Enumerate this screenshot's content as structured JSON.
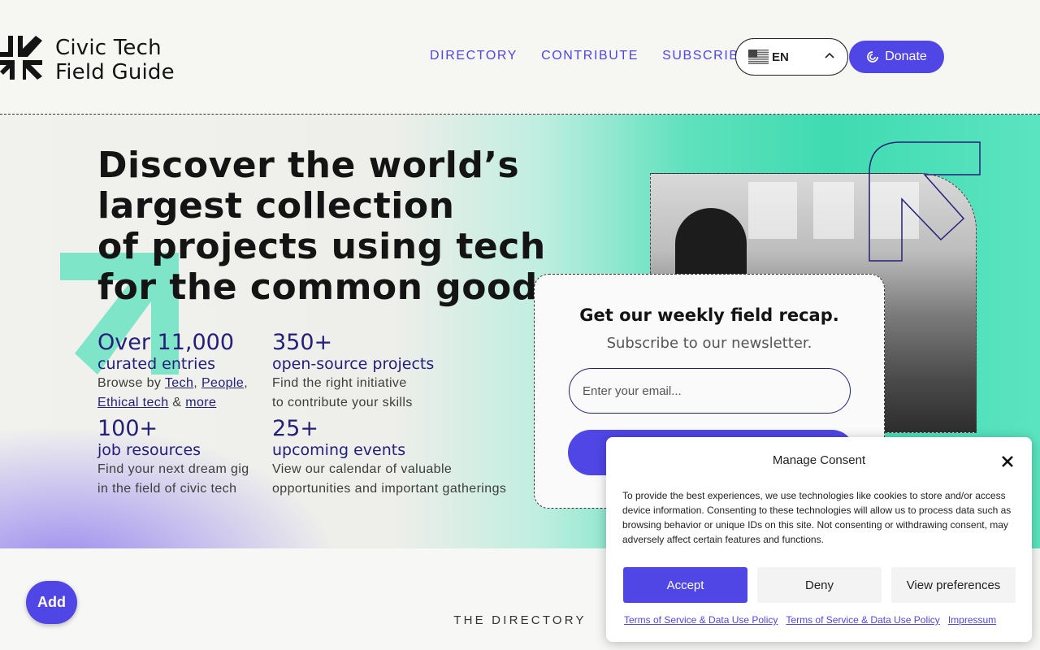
{
  "header": {
    "logo_line1": "Civic Tech",
    "logo_line2": "Field Guide",
    "nav": [
      "DIRECTORY",
      "CONTRIBUTE",
      "SUBSCRIBE"
    ],
    "language": "EN",
    "donate_label": "Donate"
  },
  "hero": {
    "heading_lines": [
      "Discover the world’s",
      "largest collection",
      "of projects using tech",
      "for the common good."
    ],
    "stats": [
      {
        "num": "Over 11,000",
        "sub": "curated entries",
        "desc_prefix": "Browse by ",
        "links": [
          "Tech",
          "People",
          "Ethical tech",
          "more"
        ]
      },
      {
        "num": "350+",
        "sub": "open-source projects",
        "desc_line1": "Find the right initiative",
        "desc_line2": "to contribute your skills"
      },
      {
        "num": "100+",
        "sub": "job resources",
        "desc_line1": "Find your next dream gig",
        "desc_line2": "in the field of civic tech"
      },
      {
        "num": "25+",
        "sub": "upcoming events",
        "desc_line1": "View our calendar of valuable",
        "desc_line2": "opportunities and important gatherings"
      }
    ]
  },
  "newsletter": {
    "title": "Get our weekly field recap.",
    "subtitle": "Subscribe to our newsletter.",
    "email_placeholder": "Enter your email..."
  },
  "add_label": "Add",
  "directory": {
    "eyebrow": "THE DIRECTORY"
  },
  "consent": {
    "title": "Manage Consent",
    "text": "To provide the best experiences, we use technologies like cookies to store and/or access device information. Consenting to these technologies will allow us to process data such as browsing behavior or unique IDs on this site. Not consenting or withdrawing consent, may adversely affect certain features and functions.",
    "accept": "Accept",
    "deny": "Deny",
    "preferences": "View preferences",
    "links": [
      "Terms of Service & Data Use Policy",
      "Terms of Service & Data Use Policy",
      "Impressum"
    ]
  },
  "colors": {
    "accent": "#4f46e5",
    "navy": "#24207a",
    "mint": "#3fdbb1",
    "lavender": "#8b78f0"
  },
  "icons": {
    "logo": "logo-arrows-icon",
    "flag": "us-flag-icon",
    "chevron": "chevron-up-icon",
    "donate": "donate-swirl-icon",
    "close": "close-icon"
  }
}
